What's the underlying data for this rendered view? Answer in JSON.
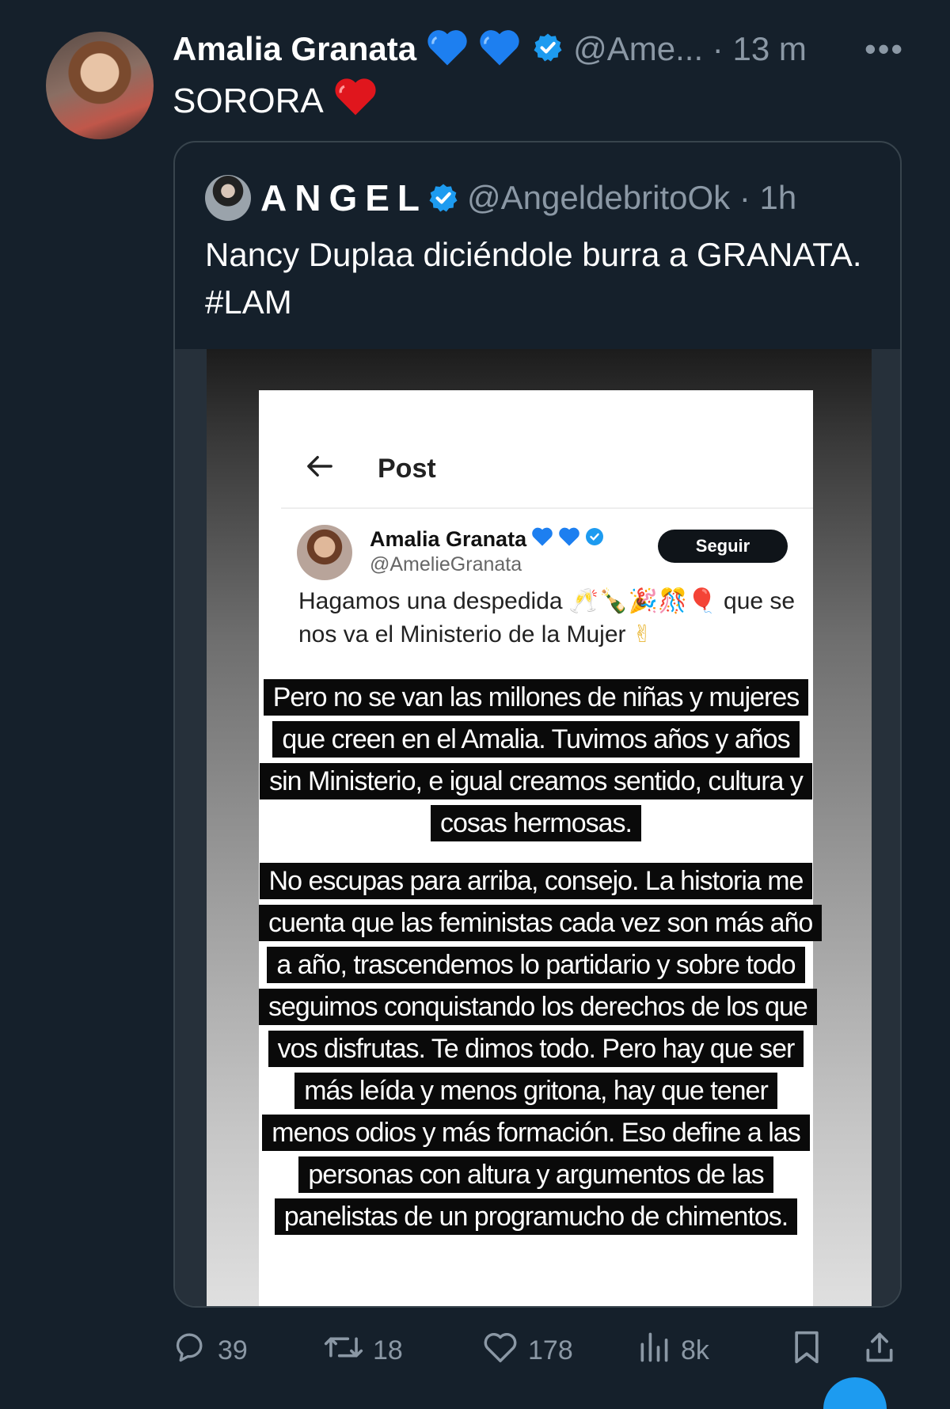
{
  "tweet": {
    "author_name": "Amalia Granata",
    "emoji_hearts": [
      "blue-heart",
      "blue-heart"
    ],
    "handle_time": "@Ame... · 13 m",
    "text": "SORORA",
    "text_emoji": "red-heart"
  },
  "quote": {
    "author_name": "ANGEL",
    "handle_time": "@AngeldebritoOk · 1h",
    "text": "Nancy Duplaa diciéndole burra a GRANATA. #LAM"
  },
  "media": {
    "post_title": "Post",
    "author_name": "Amalia Granata",
    "handle": "@AmelieGranata",
    "follow_label": "Seguir",
    "post_text_a": "Hagamos una despedida",
    "post_text_emojis": "🥂🍾🎉🎊🎈",
    "post_text_b": "que se nos va el Ministerio de la Mujer",
    "post_text_end_emoji": "✌",
    "story_paragraph_1": "Pero no se van las millones de niñas y mujeres que creen en el Amalia. Tuvimos años y años sin Ministerio, e igual creamos sentido, cultura y cosas hermosas.",
    "story_paragraph_2": "No escupas para arriba, consejo. La historia me cuenta que las feministas cada vez son más año a año, trascendemos lo partidario y sobre todo seguimos conquistando los derechos de los que vos disfrutas. Te dimos todo. Pero hay que ser más leída y menos gritona, hay que tener menos odios y más formación. Eso define a las personas con altura y argumentos de las panelistas de un programucho de chimentos."
  },
  "actions": {
    "replies": "39",
    "retweets": "18",
    "likes": "178",
    "views": "8k"
  },
  "colors": {
    "background": "#15202b",
    "verified": "#1d9bf0",
    "muted": "#8b98a5"
  }
}
